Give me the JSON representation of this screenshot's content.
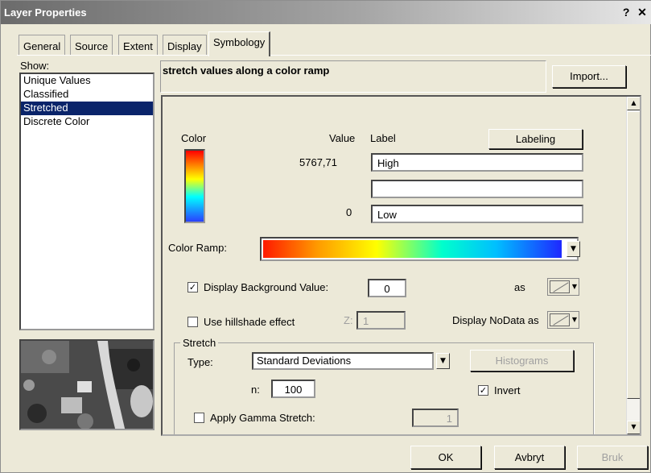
{
  "window": {
    "title": "Layer Properties",
    "help": "?",
    "close": "✕"
  },
  "tabs": [
    {
      "label": "General"
    },
    {
      "label": "Source"
    },
    {
      "label": "Extent"
    },
    {
      "label": "Display"
    },
    {
      "label": "Symbology"
    }
  ],
  "show": {
    "label": "Show:",
    "items": [
      "Unique Values",
      "Classified",
      "Stretched",
      "Discrete Color"
    ],
    "selected": "Stretched"
  },
  "description": "stretch values along a color ramp",
  "import_button": "Import...",
  "symbology": {
    "color_header": "Color",
    "value_header": "Value",
    "label_header": "Label",
    "labeling_button": "Labeling",
    "high_value": "5767,71",
    "high_label": "High",
    "mid_label": "",
    "low_value": "0",
    "low_label": "Low",
    "color_ramp_label": "Color Ramp:",
    "display_bg_label": "Display Background Value:",
    "display_bg_checked": true,
    "display_bg_value": "0",
    "as_label": "as",
    "hillshade_label": "Use hillshade effect",
    "hillshade_checked": false,
    "z_label": "Z:",
    "z_value": "1",
    "nodata_label": "Display NoData as"
  },
  "stretch": {
    "title": "Stretch",
    "type_label": "Type:",
    "type_value": "Standard Deviations",
    "histograms_button": "Histograms",
    "n_label": "n:",
    "n_value": "100",
    "invert_label": "Invert",
    "invert_checked": true,
    "gamma_label": "Apply Gamma Stretch:",
    "gamma_checked": false,
    "gamma_value": "1"
  },
  "footer": {
    "ok": "OK",
    "cancel": "Avbryt",
    "apply": "Bruk"
  },
  "colors": {
    "selection": "#0a246a",
    "dialog_bg": "#ece9d8"
  }
}
